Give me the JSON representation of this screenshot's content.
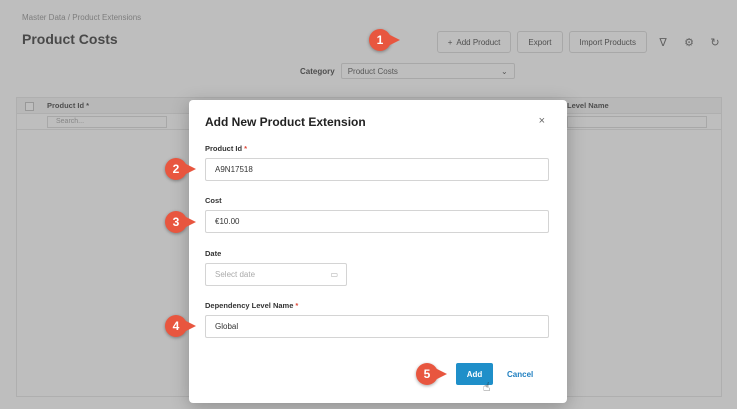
{
  "breadcrumb": "Master Data / Product Extensions",
  "page_title": "Product Costs",
  "toolbar": {
    "add_product": "Add Product",
    "add_icon": "+",
    "export": "Export",
    "import_products": "Import Products",
    "filter_icon": "∇",
    "settings_icon": "⚙",
    "refresh_icon": "↻"
  },
  "category": {
    "label": "Category",
    "value": "Product Costs",
    "chevron": "⌄"
  },
  "grid": {
    "columns": [
      "Product Id *",
      "Level Name"
    ],
    "search_placeholder": "Search..."
  },
  "modal": {
    "title": "Add New Product Extension",
    "close_icon": "×",
    "fields": {
      "product_id": {
        "label": "Product Id",
        "required": "*",
        "value": "A9N17518"
      },
      "cost": {
        "label": "Cost",
        "value": "€10.00"
      },
      "date": {
        "label": "Date",
        "placeholder": "Select date",
        "icon": "▭"
      },
      "dependency_level_name": {
        "label": "Dependency Level Name",
        "required": "*",
        "value": "Global"
      }
    },
    "add_label": "Add",
    "cancel_label": "Cancel"
  },
  "callouts": [
    "1",
    "2",
    "3",
    "4",
    "5"
  ],
  "colors": {
    "callout": "#e8563f",
    "primary_button": "#1f8fc9",
    "link": "#1f7fc0"
  }
}
